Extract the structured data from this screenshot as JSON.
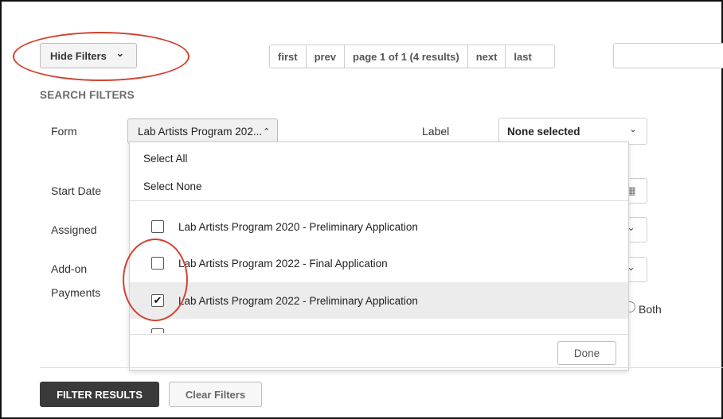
{
  "toolbar": {
    "hide_filters_label": "Hide Filters",
    "hide_filters_chevron": "⌄"
  },
  "pager": {
    "first": "first",
    "prev": "prev",
    "status": "page 1 of 1 (4 results)",
    "next": "next",
    "last": "last"
  },
  "search_input": {
    "value": "",
    "placeholder": ""
  },
  "filters": {
    "title": "SEARCH FILTERS",
    "form_label": "Form",
    "form_value": "Lab Artists Program 202...",
    "label_label": "Label",
    "label_value": "None selected",
    "start_date_label": "Start Date",
    "assigned_label": "Assigned",
    "addon_label": "Add-on",
    "payments_label": "Payments",
    "payments_option_both": "Both"
  },
  "dropdown": {
    "select_all": "Select All",
    "select_none": "Select None",
    "options": [
      {
        "label": "Lab Artists Program 2020 - Preliminary Application",
        "checked": false
      },
      {
        "label": "Lab Artists Program 2022 - Final Application",
        "checked": false
      },
      {
        "label": "Lab Artists Program 2022 - Preliminary Application",
        "checked": true
      }
    ],
    "done_label": "Done"
  },
  "actions": {
    "filter_results_label": "FILTER RESULTS",
    "clear_filters_label": "Clear Filters"
  },
  "icons": {
    "checkmark": "✔",
    "chevron_down": "⌄",
    "chevron_up": "⌃",
    "calendar": "▦"
  },
  "colors": {
    "annotation_red": "#d2412e",
    "primary_button": "#3a3a3a",
    "highlight_row": "#ececec"
  }
}
